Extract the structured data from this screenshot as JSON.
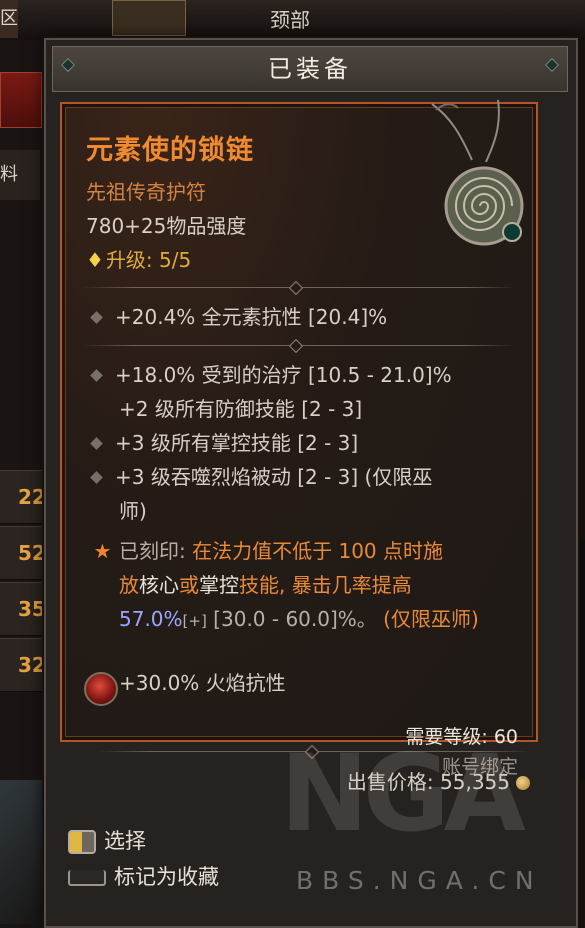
{
  "background": {
    "slot_label": "颈部",
    "left_tab_1": "区",
    "left_tab_2": "料",
    "row_values": [
      "22",
      "52",
      "35",
      "32"
    ]
  },
  "window": {
    "header_title": "已装备"
  },
  "item": {
    "name": "元素使的锁链",
    "type": "先祖传奇护符",
    "power": "780+25物品强度",
    "upgrade_label": "升级: 5/5",
    "name_color": "#f08a31",
    "type_color": "#d38444"
  },
  "affixes": {
    "implicit": "+20.4% 全元素抗性 [20.4]%",
    "lines": [
      "+18.0% 受到的治疗 [10.5 - 21.0]%",
      "+2 级所有防御技能 [2 - 3]",
      "+3 级所有掌控技能 [2 - 3]",
      "+3 级吞噬烈焰被动 [2 - 3] (仅限巫",
      "师)"
    ],
    "aspect": {
      "prefix": "已刻印:",
      "seg1": "在法力值不低于 100 点时施",
      "seg2": "放",
      "seg3": "核心",
      "seg4": "或",
      "seg5": "掌控",
      "seg6": "技能, 暴击几率提高",
      "value": "57.0%",
      "bracket_plus": "[+]",
      "range": " [30.0 - 60.0]%。",
      "class_note": " (仅限巫师)"
    },
    "socket": "+30.0% 火焰抗性"
  },
  "requirements": {
    "level": "需要等级: 60",
    "bound": "账号绑定"
  },
  "sell": {
    "label": "出售价格:",
    "value": "55,355"
  },
  "controls": {
    "select": "选择",
    "favorite": "标记为收藏"
  },
  "watermark": {
    "big": "NGA",
    "small": "BBS.NGA.CN"
  }
}
